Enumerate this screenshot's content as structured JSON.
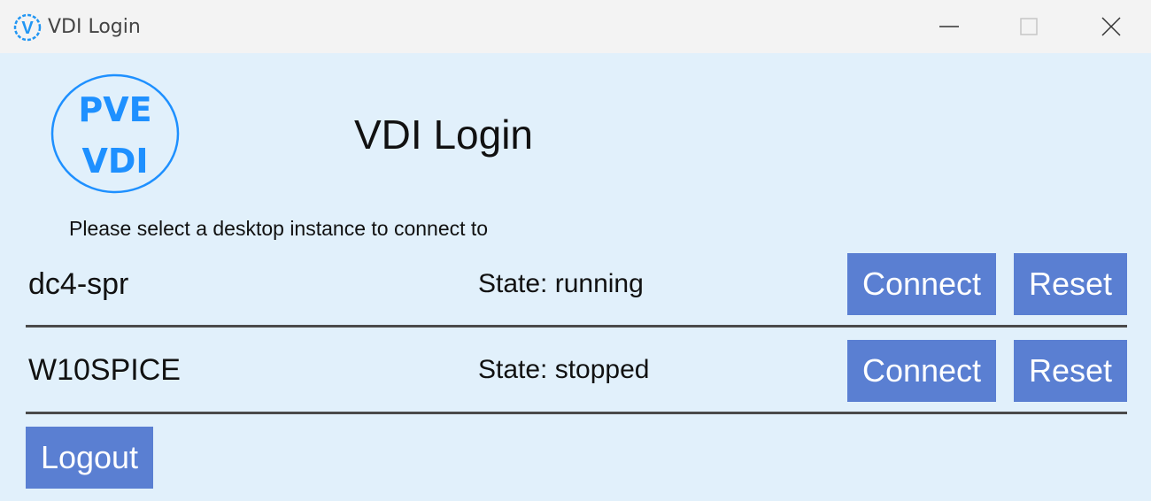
{
  "window": {
    "title": "VDI Login",
    "icon_letter": "V",
    "accent": "#2196f3"
  },
  "logo": {
    "line1": "PVE",
    "line2": "VDI",
    "color": "#1e90ff"
  },
  "header": {
    "title": "VDI Login",
    "subtitle": "Please select a desktop instance to connect to"
  },
  "instances": [
    {
      "name": "dc4-spr",
      "state": "State: running",
      "connect_label": "Connect",
      "reset_label": "Reset"
    },
    {
      "name": "W10SPICE",
      "state": "State: stopped",
      "connect_label": "Connect",
      "reset_label": "Reset"
    }
  ],
  "footer": {
    "logout_label": "Logout"
  },
  "colors": {
    "button_bg": "#5a7fd2",
    "client_bg": "#e1f0fb",
    "titlebar_bg": "#f3f3f3"
  }
}
